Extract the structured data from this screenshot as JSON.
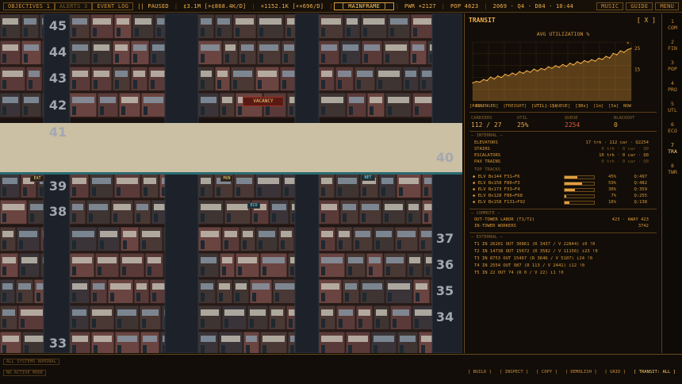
{
  "topbar": {
    "objectives": "OBJECTIVES",
    "objectives_count": "1",
    "alerts": "ALERTS",
    "alerts_count": "3",
    "event_log": "EVENT LOG",
    "pause_icon": "||",
    "paused": "PAUSED",
    "money": "¢3.1M [+¢868.4K/D]",
    "credits": "¤1152.1K [+¤696/D]",
    "mode": "[ MAINFRAME ]",
    "power": "PWR +2127",
    "pop": "POP 4623",
    "date": "2069 · Q4 · D84 · 10:44",
    "music": "MUSIC",
    "guide": "GUIDE",
    "menu": "MENU"
  },
  "floors": [
    "45",
    "44",
    "43",
    "42",
    "41",
    "40",
    "39",
    "38",
    "37",
    "36",
    "35",
    "34",
    "33"
  ],
  "signage": {
    "vacancy": "VACANCY",
    "sign2": "EAT",
    "sign3": "NET",
    "sign4": "MUN",
    "sign5": "ECO"
  },
  "panel": {
    "title": "TRANSIT",
    "close": "[ X ]",
    "chart_title": "AVG UTILIZATION %",
    "x_left": "-30s",
    "x_mid": "-15s",
    "x_right": "NOW",
    "tabs": [
      "[PASSENGER]",
      "[FREIGHT]",
      "[UTIL]",
      "[QUEUE]",
      "[30s]",
      "[1m]",
      "[5m]"
    ],
    "kpi_labels": [
      "CARRIERS",
      "UTIL",
      "QUEUE",
      "BLACKOUT"
    ],
    "kpi_values": [
      "112 / 27",
      "25%",
      "2254",
      "0"
    ],
    "internal_header": "— INTERNAL —",
    "internal": [
      {
        "name": "ELEVATORS",
        "value": "17 trk · 112 car · Q2254"
      },
      {
        "name": "STAIRS",
        "value": "0 trk · 0 car · Q0"
      },
      {
        "name": "ESCALATORS",
        "value": "10 trk · 0 car · Q0"
      },
      {
        "name": "PAX TRAINS",
        "value": "0 trk · 0 car · Q0"
      }
    ],
    "top_tracks_header": "TOP TRACKS",
    "tracks": [
      {
        "name": "ELV Bx144 F31→F6",
        "pct": "45%",
        "q": "Q:497",
        "fill": 0.45
      },
      {
        "name": "ELV Bx158 F80→F3",
        "pct": "59%",
        "q": "Q:482",
        "fill": 0.59
      },
      {
        "name": "ELV Bx173 F33→F4",
        "pct": "36%",
        "q": "Q:359",
        "fill": 0.36
      },
      {
        "name": "ELV Bx128 F86→F68",
        "pct": "7%",
        "q": "Q:255",
        "fill": 0.07
      },
      {
        "name": "ELV Bx158 F131→F92",
        "pct": "16%",
        "q": "Q:138",
        "fill": 0.16
      }
    ],
    "commute_header": "— COMMUTE —",
    "commute": [
      {
        "name": "OUT-TOWER LABOR (T1/T2)",
        "value": "423 · AWAY 423"
      },
      {
        "name": "IN-TOWER WORKERS",
        "value": "3742"
      }
    ],
    "external_header": "— EXTERNAL —",
    "external": [
      "T1  IN 26201  OUT 30861  (R 3437 / V 22844)  i0 !0",
      "T2  IN 14738  OUT 15672  (R 3582 / V 11156)  i23 !0",
      "T3  IN 8753  OUT 15467  (R 3646 / V 5107)  i24 !0",
      "T4  IN 2554  OUT 987  (R 113 / V 2441)  i12 !0",
      "T5  IN 22  OUT 74  (R 0 / V 22)  i1 !0"
    ]
  },
  "chart_data": {
    "type": "area",
    "title": "AVG UTILIZATION %",
    "xlabel": "",
    "ylabel": "",
    "x_ticks": [
      "-30s",
      "-15s",
      "NOW"
    ],
    "y_ticks": [
      "25",
      "15"
    ],
    "ylim": [
      0,
      28
    ],
    "values": [
      8.5,
      9.2,
      8.9,
      10.1,
      9.6,
      11.3,
      10.4,
      11.8,
      11.1,
      12.6,
      11.9,
      13.2,
      12.4,
      13.9,
      13.1,
      14.3,
      13.6,
      15.1,
      14.2,
      15.4,
      14.8,
      16.2,
      15.5,
      16.7,
      16.0,
      17.3,
      16.4,
      17.9,
      17.1,
      18.6,
      17.8,
      19.1,
      18.4,
      19.6,
      18.9,
      20.3,
      19.7,
      21.2,
      20.4,
      22.6,
      21.9,
      23.8,
      23.1,
      24.4,
      25.0
    ],
    "color": "#e09a3a"
  },
  "rail": [
    {
      "n": "1",
      "l": "COM"
    },
    {
      "n": "2",
      "l": "FIN"
    },
    {
      "n": "3",
      "l": "POP"
    },
    {
      "n": "4",
      "l": "PRO"
    },
    {
      "n": "5",
      "l": "UTL"
    },
    {
      "n": "6",
      "l": "ECO"
    },
    {
      "n": "7",
      "l": "TRA"
    },
    {
      "n": "8",
      "l": "TWR"
    }
  ],
  "bottom": {
    "status1": "ALL SYSTEMS NOMINAL",
    "status2": "NO ACTIVE MODE",
    "buttons": [
      "[ BUILD ]",
      "[ INSPECT ]",
      "[ COPY ]",
      "[ DEMOLISH ]",
      "[ GRID ]",
      "[ TRANSIT: ALL ]"
    ]
  },
  "colors": {
    "accent": "#d89a3c",
    "bright": "#ffcf6a",
    "bg": "#120d08"
  }
}
